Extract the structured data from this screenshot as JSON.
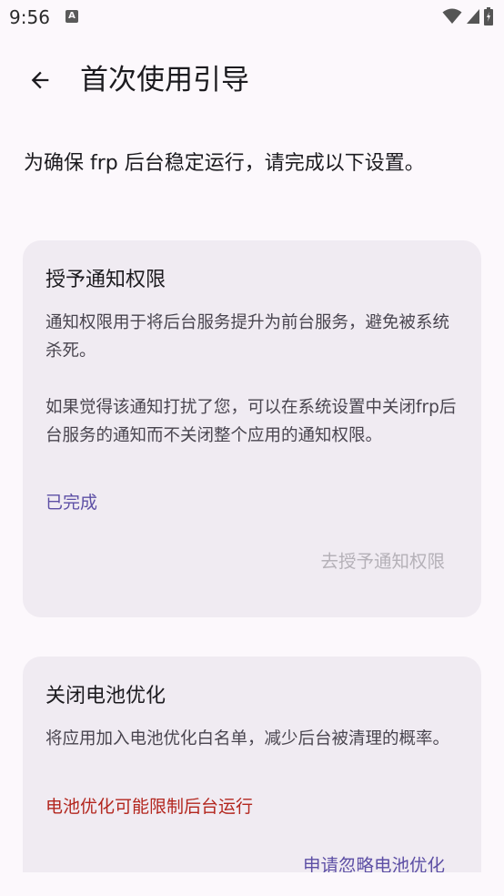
{
  "status_bar": {
    "time": "9:56",
    "notification_icon": "A"
  },
  "app_bar": {
    "title": "首次使用引导"
  },
  "intro_text": "为确保 frp 后台稳定运行，请完成以下设置。",
  "cards": [
    {
      "title": "授予通知权限",
      "body": [
        "通知权限用于将后台服务提升为前台服务，避免被系统杀死。",
        "如果觉得该通知打扰了您，可以在系统设置中关闭frp后台服务的通知而不关闭整个应用的通知权限。"
      ],
      "status": "已完成",
      "action": "去授予通知权限"
    },
    {
      "title": "关闭电池优化",
      "body": [
        "将应用加入电池优化白名单，减少后台被清理的概率。"
      ],
      "status": "电池优化可能限制后台运行",
      "action": "申请忽略电池优化"
    }
  ],
  "colors": {
    "background": "#fcf8fc",
    "card": "#f0ebf2",
    "accent": "#5d4fa5",
    "warning": "#b3261e",
    "disabled": "#b5b1b8"
  }
}
